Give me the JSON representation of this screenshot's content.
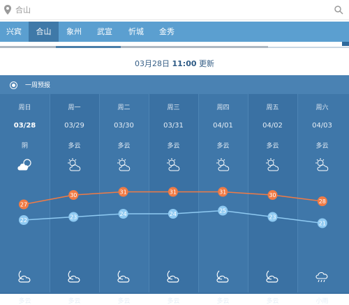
{
  "search": {
    "placeholder": "合山"
  },
  "tabs": [
    {
      "label": "兴宾",
      "active": false
    },
    {
      "label": "合山",
      "active": true
    },
    {
      "label": "象州",
      "active": false
    },
    {
      "label": "武宣",
      "active": false
    },
    {
      "label": "忻城",
      "active": false
    },
    {
      "label": "金秀",
      "active": false
    }
  ],
  "updated": {
    "date": "03月28日",
    "time": "11:00",
    "suffix": "更新"
  },
  "forecast": {
    "title": "一周预报",
    "days": [
      {
        "day": "周日",
        "date": "03/28",
        "cond_day": "阴",
        "icon_day": "overcast-icon",
        "cond_night": "多云",
        "icon_night": "cloudy-night-icon"
      },
      {
        "day": "周一",
        "date": "03/29",
        "cond_day": "多云",
        "icon_day": "partly-cloudy-icon",
        "cond_night": "多云",
        "icon_night": "cloudy-night-icon"
      },
      {
        "day": "周二",
        "date": "03/30",
        "cond_day": "多云",
        "icon_day": "partly-cloudy-icon",
        "cond_night": "多云",
        "icon_night": "cloudy-night-icon"
      },
      {
        "day": "周三",
        "date": "03/31",
        "cond_day": "多云",
        "icon_day": "partly-cloudy-icon",
        "cond_night": "多云",
        "icon_night": "cloudy-night-icon"
      },
      {
        "day": "周四",
        "date": "04/01",
        "cond_day": "多云",
        "icon_day": "partly-cloudy-icon",
        "cond_night": "多云",
        "icon_night": "cloudy-night-icon"
      },
      {
        "day": "周五",
        "date": "04/02",
        "cond_day": "多云",
        "icon_day": "partly-cloudy-icon",
        "cond_night": "多云",
        "icon_night": "cloudy-night-icon"
      },
      {
        "day": "周六",
        "date": "04/03",
        "cond_day": "多云",
        "icon_day": "partly-cloudy-icon",
        "cond_night": "小雨",
        "icon_night": "light-rain-icon"
      }
    ]
  },
  "chart_data": {
    "type": "line",
    "categories": [
      "03/28",
      "03/29",
      "03/30",
      "03/31",
      "04/01",
      "04/02",
      "04/03"
    ],
    "series": [
      {
        "values": [
          27,
          30,
          31,
          31,
          31,
          30,
          28
        ],
        "color": "#f07b45"
      },
      {
        "values": [
          22,
          23,
          24,
          24,
          25,
          23,
          21
        ],
        "color": "#8fcaf2"
      }
    ],
    "ylim": [
      18,
      34
    ]
  },
  "colors": {
    "tab_bar": "#5b9fd0",
    "tab_active": "#3f79a8",
    "panel": "#3a71a3",
    "high": "#f07b45",
    "low": "#8fcaf2"
  }
}
